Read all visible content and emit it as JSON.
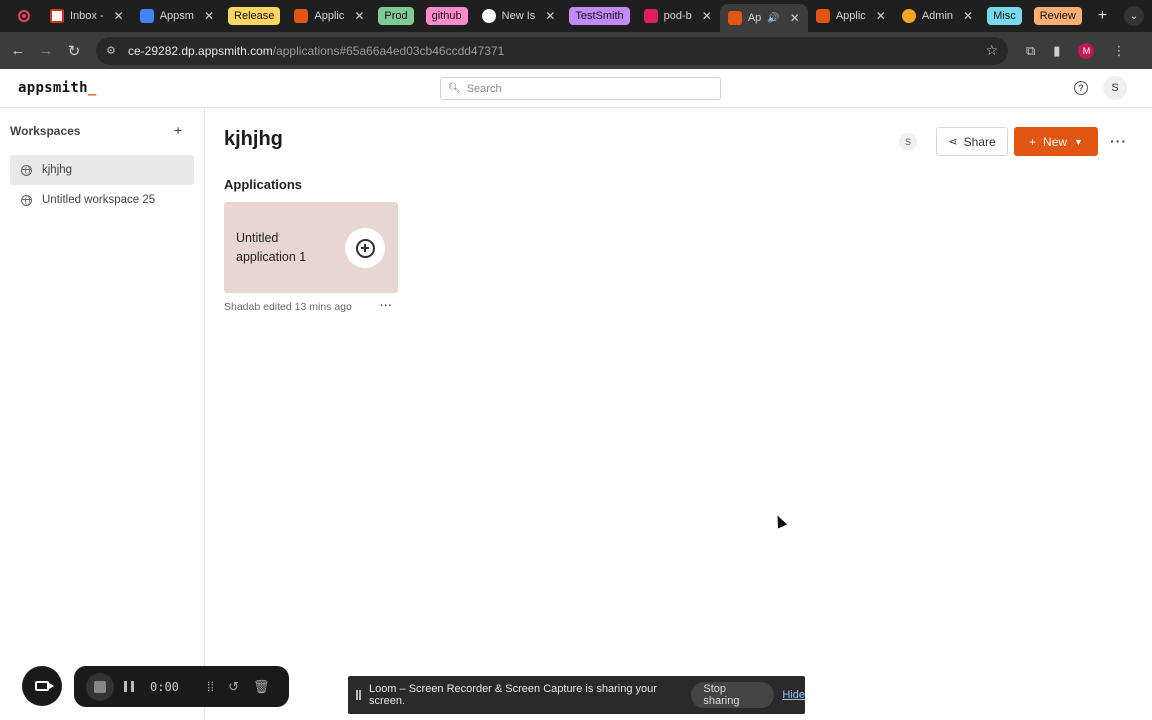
{
  "browser": {
    "tabs": [
      {
        "label": "",
        "type": "recording"
      },
      {
        "label": "Inbox -",
        "icon": "gmail-icon",
        "color": "#d93025"
      },
      {
        "label": "Appsm",
        "icon": "calendar-icon",
        "color": "#4285f4"
      },
      {
        "group": "Release",
        "color": "#fdd663"
      },
      {
        "label": "Applic",
        "icon": "appsmith-icon",
        "color": "#e15615"
      },
      {
        "group": "Prod",
        "color": "#81c995"
      },
      {
        "group": "github",
        "color": "#ff8bcb"
      },
      {
        "label": "New Is",
        "icon": "github-icon",
        "color": "#ffffff"
      },
      {
        "group": "TestSmith",
        "color": "#c58af9"
      },
      {
        "label": "pod-b",
        "icon": "slack-icon",
        "color": "#e01e5a"
      },
      {
        "label": "Ap",
        "icon": "appsmith-icon",
        "color": "#e15615",
        "active": true
      },
      {
        "label": "Applic",
        "icon": "appsmith-icon",
        "color": "#e15615"
      },
      {
        "label": "Admin",
        "icon": "admin-icon",
        "color": "#f5a623"
      },
      {
        "group": "Misc",
        "color": "#78d9ec"
      },
      {
        "group": "Review",
        "color": "#fcad70"
      }
    ],
    "url_host": "ce-29282.dp.appsmith.com",
    "url_path": "/applications#65a66a4ed03cb46ccdd47371",
    "profile_initial": "M"
  },
  "header": {
    "logo": "appsmith",
    "logo_cursor": "_",
    "search_placeholder": "Search",
    "user_initial": "S"
  },
  "sidebar": {
    "title": "Workspaces",
    "items": [
      {
        "label": "kjhjhg",
        "active": true
      },
      {
        "label": "Untitled workspace 25",
        "active": false
      }
    ]
  },
  "main": {
    "workspace_title": "kjhjhg",
    "member_initial": "S",
    "share_label": "Share",
    "new_label": "New",
    "section_heading": "Applications",
    "app": {
      "name": "Untitled application 1",
      "meta": "Shadab edited 13 mins ago",
      "card_color": "#e8d6d2"
    }
  },
  "loom": {
    "timer": "0:00",
    "banner_text": "Loom – Screen Recorder & Screen Capture is sharing your screen.",
    "stop_label": "Stop sharing",
    "hide_label": "Hide"
  },
  "colors": {
    "accent": "#e15615",
    "chrome_dark": "#1f1f1f"
  }
}
